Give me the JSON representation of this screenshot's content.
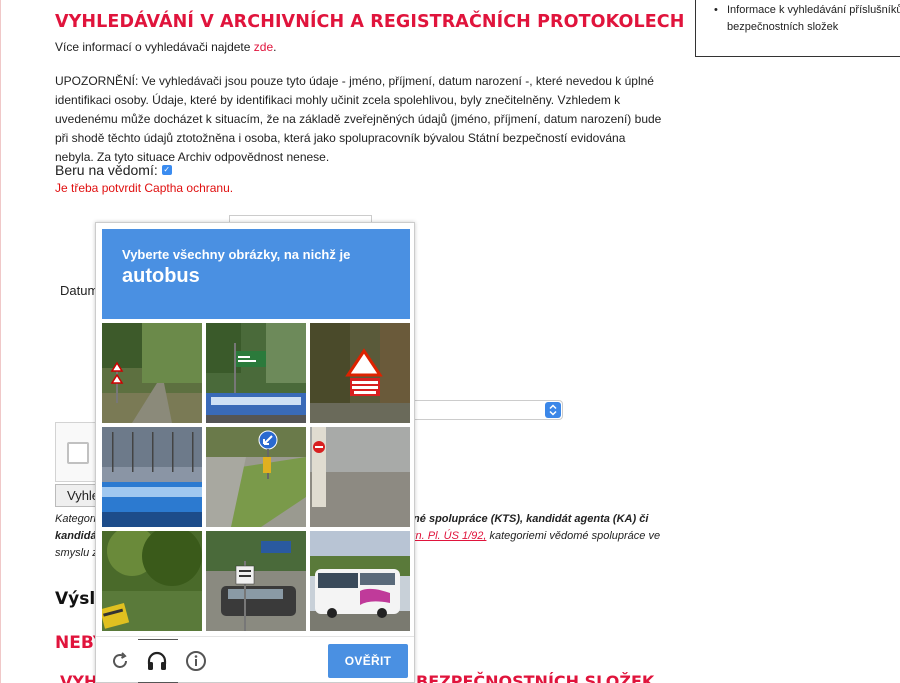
{
  "page": {
    "title": "VYHLEDÁVÁNÍ V ARCHIVNÍCH A REGISTRAČNÍCH PROTOKOLECH",
    "intro_text": "Více informací o vyhledávači najdete ",
    "intro_link": "zde",
    "intro_end": ".",
    "warning": "UPOZORNĚNÍ: Ve vyhledávači jsou pouze tyto údaje - jméno, příjmení, datum narození -, které nevedou k úplné identifikaci osoby. Údaje, které by identifikaci mohly učinit zcela spolehlivou, byly znečitelněny. Vzhledem k uvedenému může docházet k situacím, že na základě zveřejněných údajů (jméno, příjmení, datum narození) bude při shodě těchto údajů ztotožněna i osoba, která jako spolupracovník bývalou Státní bezpečností evidována nebyla. Za tyto situace Archiv odpovědnost nenese.",
    "ack_label": "Beru na vědomí:",
    "captcha_error": "Je třeba potvrdit Captha ochranu.",
    "datum_label": "Datum",
    "search_button": "Vyhledat",
    "categories_left_line1": "Kategori",
    "categories_left_line2": "kandidá",
    "categories_left_line3": "smyslu z",
    "categories_right_line1": "íné spolupráce (KTS), kandidát agenta (KA) či",
    "categories_right_line2_link": "zn. Pl. ÚS 1/92,",
    "categories_right_line2_text": " kategoriemi vědomé spolupráce ve",
    "results_heading": "Výsledky",
    "red_heading": "NEBYLY",
    "bottom_heading_left": "VYHLEDÁVÁNÍ",
    "bottom_heading_right": "BEZPEČNOSTNÍCH SLOŽEK"
  },
  "sidebar": {
    "item": "Informace k vyhledávání příslušníků bezpečnostních složek"
  },
  "challenge": {
    "instruction": "Vyberte všechny obrázky, na nichž je",
    "target": "autobus",
    "verify_label": "OVĚŘIT",
    "tiles": [
      {
        "desc": "forest road with warning signs"
      },
      {
        "desc": "street with green signs and bus"
      },
      {
        "desc": "reduce speed now sign"
      },
      {
        "desc": "blue bus in station"
      },
      {
        "desc": "road curb with blue sign"
      },
      {
        "desc": "road with no entry sign"
      },
      {
        "desc": "trees and yellow sign"
      },
      {
        "desc": "car and street signs"
      },
      {
        "desc": "white tour bus on road"
      }
    ],
    "signs": {
      "reduce_speed": "REDUCE SPEED NOW",
      "left_on_green": "LEFT ON GREEN",
      "bus_text": "ede e'press"
    }
  },
  "colors": {
    "accent_red": "#e0143c",
    "challenge_blue": "#4a90e2"
  }
}
